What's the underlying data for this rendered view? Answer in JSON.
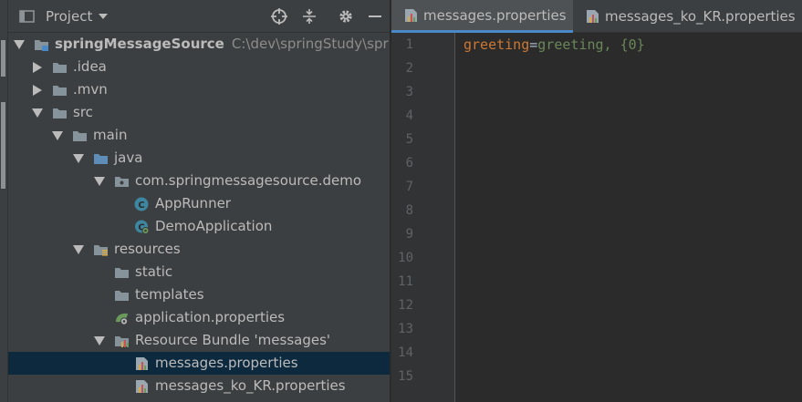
{
  "project_panel": {
    "title": "Project",
    "tree": [
      {
        "label": "springMessageSource",
        "path": "C:\\dev\\springStudy\\springMessageSource",
        "icon": "module-folder-icon"
      },
      {
        "label": ".idea",
        "icon": "folder-icon"
      },
      {
        "label": ".mvn",
        "icon": "folder-icon"
      },
      {
        "label": "src",
        "icon": "folder-icon"
      },
      {
        "label": "main",
        "icon": "folder-icon"
      },
      {
        "label": "java",
        "icon": "source-folder-icon"
      },
      {
        "label": "com.springmessagesource.demo",
        "icon": "package-icon"
      },
      {
        "label": "AppRunner",
        "icon": "class-icon"
      },
      {
        "label": "DemoApplication",
        "icon": "spring-boot-class-icon"
      },
      {
        "label": "resources",
        "icon": "resources-folder-icon"
      },
      {
        "label": "static",
        "icon": "folder-icon"
      },
      {
        "label": "templates",
        "icon": "folder-icon"
      },
      {
        "label": "application.properties",
        "icon": "spring-properties-icon"
      },
      {
        "label": "Resource Bundle 'messages'",
        "icon": "resource-bundle-icon"
      },
      {
        "label": "messages.properties",
        "icon": "properties-file-icon"
      },
      {
        "label": "messages_ko_KR.properties",
        "icon": "properties-file-icon"
      }
    ]
  },
  "editor": {
    "tabs": [
      {
        "label": "messages.properties",
        "active": true
      },
      {
        "label": "messages_ko_KR.properties",
        "active": false
      }
    ],
    "line_numbers": [
      "1",
      "2",
      "3",
      "4",
      "5",
      "6",
      "7",
      "8",
      "9",
      "10",
      "11",
      "12",
      "13",
      "14",
      "15"
    ],
    "code": {
      "key": "greeting",
      "sep": "=",
      "value": "greeting, {0}"
    }
  },
  "colors": {
    "panel_bg": "#3c3f41",
    "editor_bg": "#2b2b2b",
    "selection_bg": "#0d293e",
    "key_color": "#cc7832",
    "value_color": "#6a8759",
    "folder_color": "#87939a",
    "source_folder_color": "#5e8db8"
  }
}
